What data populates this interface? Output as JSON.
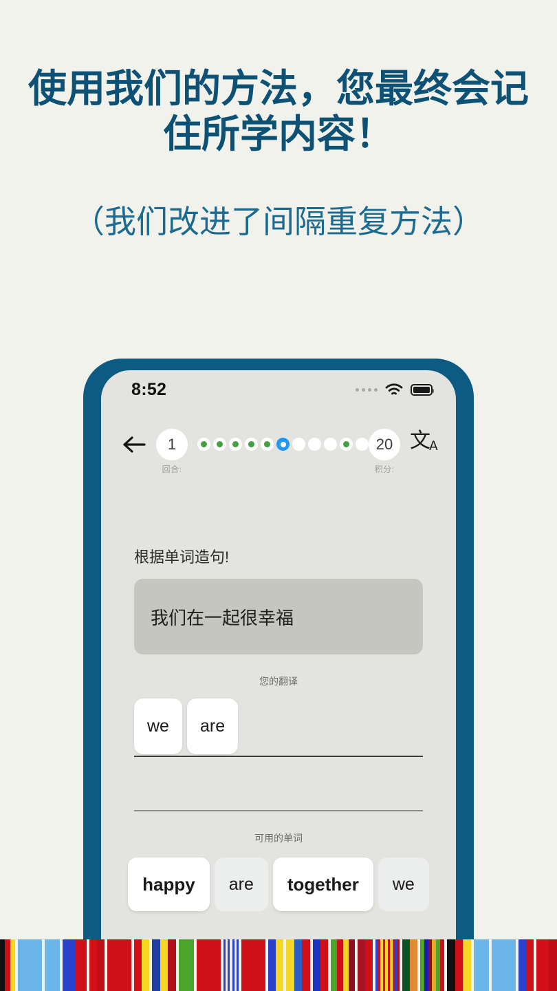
{
  "headline": "使用我们的方法，您最终会记住所学内容！",
  "subheadline": "（我们改进了间隔重复方法）",
  "phone": {
    "status_bar": {
      "time": "8:52",
      "signal_icon": "signal-dots-icon",
      "wifi_icon": "wifi-icon",
      "battery_icon": "battery-full-icon"
    },
    "nav": {
      "back_icon": "back-arrow-icon",
      "round_value": "1",
      "round_caption": "回合:",
      "score_value": "20",
      "score_caption": "积分:",
      "translate_icon": "translate-icon",
      "translate_glyph": "文",
      "translate_sub": "A",
      "progress_dots": [
        "done",
        "done",
        "done",
        "done",
        "done",
        "current",
        "empty",
        "empty",
        "empty",
        "done",
        "empty"
      ]
    },
    "content": {
      "prompt": "根据单词造句!",
      "sentence": "我们在一起很幸福",
      "your_translation_label": "您的翻译",
      "answer_chips": [
        "we",
        "are"
      ],
      "available_words_label": "可用的单词",
      "available_words": [
        {
          "word": "happy",
          "state": "available"
        },
        {
          "word": "are",
          "state": "used"
        },
        {
          "word": "together",
          "state": "available"
        },
        {
          "word": "we",
          "state": "used"
        }
      ]
    }
  },
  "colors": {
    "page_bg": "#f2f2ed",
    "headline": "#0d5275",
    "subheadline": "#1b6a91",
    "phone_frame": "#0d5b82",
    "screen_bg": "#e3e4df",
    "sentence_card": "#c6c6c1",
    "dot_done": "#44a041",
    "dot_current": "#2196f3"
  },
  "flag_strip": [
    [
      "#111111",
      "#cf1019",
      "#f6d723"
    ],
    [
      "#6cb5e8"
    ],
    [
      "#6cb5e8"
    ],
    [
      "#2b42cc",
      "#cf1019"
    ],
    [
      "#d40f18",
      "#c10d16"
    ],
    [
      "#cf1019"
    ],
    [
      "#d40f18",
      "#f6d723"
    ],
    [
      "#1e3f9e",
      "#f6d723",
      "#b01119"
    ],
    [
      "#4aa62a"
    ],
    [
      "#cf1019"
    ],
    [
      "#2b42cc",
      "#eeeeea",
      "#2b42cc",
      "#eeeeea",
      "#2b42cc",
      "#eeeeea",
      "#2b42cc"
    ],
    [
      "#cf1019"
    ],
    [
      "#2b42cc",
      "#f6d723"
    ],
    [
      "#f6d723",
      "#2b5fc4",
      "#cf1019"
    ],
    [
      "#1e33c4",
      "#cf1019"
    ],
    [
      "#4aa62a",
      "#cf1019",
      "#f6d723",
      "#8b1020"
    ],
    [
      "#a31523",
      "#cf1019"
    ],
    [
      "#2b42cc",
      "#cf1019",
      "#f6d723",
      "#cf1019",
      "#f6d723",
      "#cf1019",
      "#f6d723",
      "#cf1019",
      "#2b42cc",
      "#b01119"
    ],
    [
      "#0a5426",
      "#e08a33"
    ],
    [
      "#4aa62a",
      "#2218b5",
      "#8b1020",
      "#e8a82a",
      "#4aa62a",
      "#cf1019"
    ]
  ]
}
